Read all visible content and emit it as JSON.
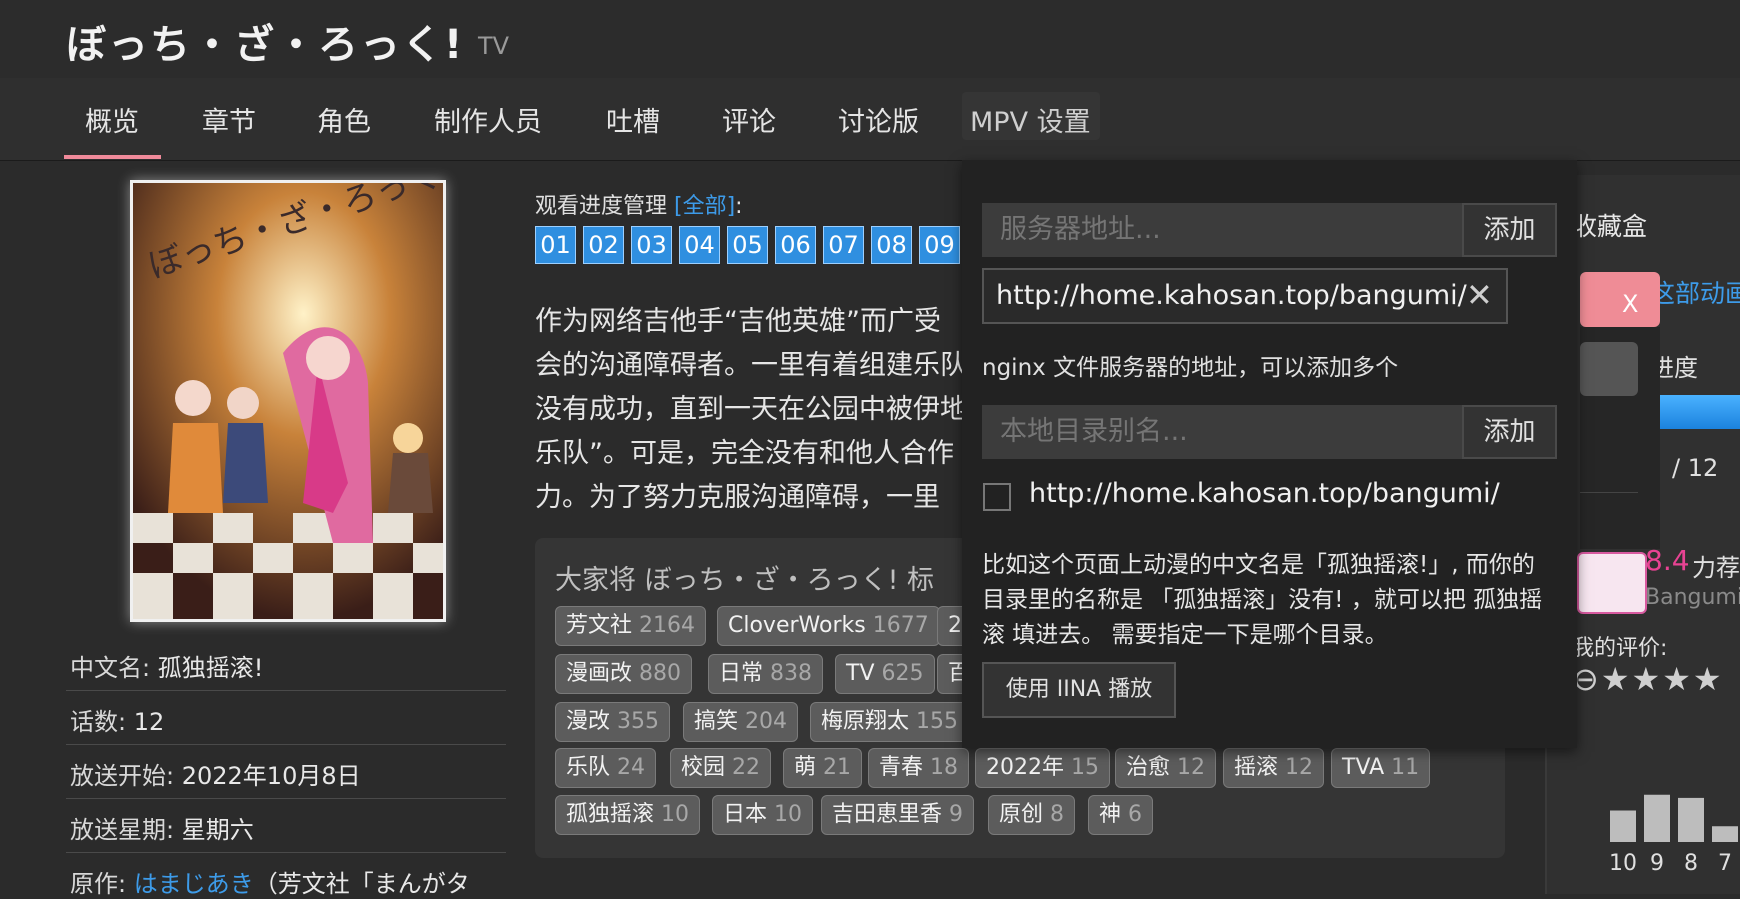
{
  "header": {
    "title": "ぼっち・ざ・ろっく!",
    "type": "TV"
  },
  "nav": {
    "tabs": [
      "概览",
      "章节",
      "角色",
      "制作人员",
      "吐槽",
      "评论",
      "讨论版",
      "MPV 设置"
    ]
  },
  "poster": {
    "alt": "ぼっち・ざ・ろっく！ poster"
  },
  "info": {
    "cn_name_k": "中文名: ",
    "cn_name_v": "孤独摇滚!",
    "eps_k": "话数: ",
    "eps_v": "12",
    "air_k": "放送开始: ",
    "air_v": "2022年10月8日",
    "week_k": "放送星期: ",
    "week_v": "星期六",
    "orig_k": "原作: ",
    "orig_link": "はまじあき",
    "orig_v": "（芳文社「まんがタ"
  },
  "progress": {
    "label": "观看进度管理 ",
    "all": "[全部]",
    "colon": ":",
    "episodes": [
      "01",
      "02",
      "03",
      "04",
      "05",
      "06",
      "07",
      "08",
      "09"
    ]
  },
  "summary": {
    "lines": [
      "作为网络吉他手“吉他英雄”而广受",
      "会的沟通障碍者。一里有着组建乐队",
      "没有成功，直到一天在公园中被伊地",
      "乐队”。可是，完全没有和他人合作",
      "力。为了努力克服沟通障碍，一里"
    ]
  },
  "tags": {
    "title": "大家将 ぼっち・ざ・ろっく! 标",
    "rows": [
      [
        {
          "name": "芳文社",
          "count": "2164"
        },
        {
          "name": "CloverWorks",
          "count": "1677"
        },
        {
          "name": "2",
          "count": ""
        }
      ],
      [
        {
          "name": "漫画改",
          "count": "880"
        },
        {
          "name": "日常",
          "count": "838"
        },
        {
          "name": "TV",
          "count": "625"
        },
        {
          "name": "百",
          "count": ""
        }
      ],
      [
        {
          "name": "漫改",
          "count": "355"
        },
        {
          "name": "搞笑",
          "count": "204"
        },
        {
          "name": "梅原翔太",
          "count": "155"
        }
      ],
      [
        {
          "name": "乐队",
          "count": "24"
        },
        {
          "name": "校园",
          "count": "22"
        },
        {
          "name": "萌",
          "count": "21"
        },
        {
          "name": "青春",
          "count": "18"
        },
        {
          "name": "2022年",
          "count": "15"
        },
        {
          "name": "治愈",
          "count": "12"
        },
        {
          "name": "摇滚",
          "count": "12"
        },
        {
          "name": "TVA",
          "count": "11"
        }
      ],
      [
        {
          "name": "孤独摇滚",
          "count": "10"
        },
        {
          "name": "日本",
          "count": "10"
        },
        {
          "name": "吉田恵里香",
          "count": "9"
        },
        {
          "name": "原创",
          "count": "8"
        },
        {
          "name": "神",
          "count": "6"
        }
      ]
    ]
  },
  "mpv": {
    "server_placeholder": "服务器地址...",
    "add_label": "添加",
    "server_chip": "http://home.kahosan.top/bangumi/",
    "server_hint": "nginx 文件服务器的地址，可以添加多个",
    "alias_placeholder": "本地目录别名...",
    "alias_add_label": "添加",
    "checkbox_label": "http://home.kahosan.top/bangumi/",
    "note": "比如这个页面上动漫的中文名是「孤独摇滚!」, 而你的目录里的名称是 「孤独摇滚」没有! ，就可以把 孤独摇滚 填进去。 需要指定一下是哪个目录。",
    "iina_button": "使用 IINA 播放"
  },
  "right": {
    "collection": "收藏盒",
    "all_anime": "这部动画",
    "progress_label": "进度",
    "ep_total": "/ 12",
    "score": "8.4",
    "recommend": "力荐",
    "bangumi": "Bangumi",
    "my_rating": "我的评价:",
    "popup_close": "X",
    "hist_labels": [
      "10",
      "9",
      "8",
      "7"
    ],
    "hist_values": [
      30,
      45,
      42,
      15
    ]
  },
  "colors": {
    "accent": "#2f8fe0",
    "pink": "#f08a9a",
    "score": "#e84393"
  }
}
